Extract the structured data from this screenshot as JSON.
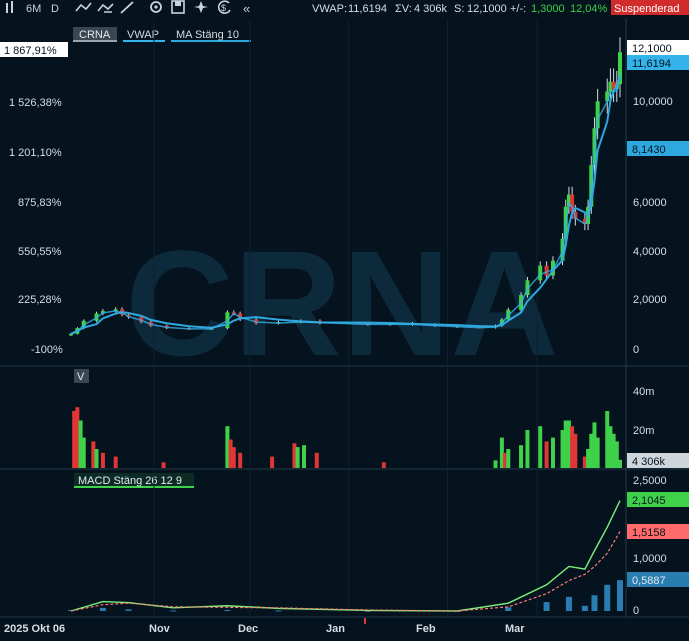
{
  "toolbar": {
    "period": "6M",
    "interval": "D",
    "icons": [
      "candlestick-icon",
      "draw-line-icon",
      "indicator-icon",
      "pencil-icon",
      "settings-icon",
      "save-icon",
      "crosshair-icon",
      "currency-icon",
      "collapse-icon"
    ],
    "vwap_label": "VWAP:",
    "vwap_value": "11,6194",
    "volume_label": "ΣV:",
    "volume_value": "4 306k",
    "last_label": "S:",
    "last_value": "12,1000",
    "change_label": "+/-:",
    "change_value": "1,3000",
    "change_pct": "12,04%",
    "status_badge": "Suspenderad"
  },
  "watermark": "CRNA",
  "price_panel": {
    "legend": [
      "CRNA",
      "VWAP",
      "MA  Stäng 10"
    ],
    "left_axis": [
      "1 867,91%",
      "1 526,38%",
      "1 201,10%",
      "875,83%",
      "550,55%",
      "225,28%",
      "-100%"
    ],
    "right_axis": [
      "10,0000",
      "8,0000",
      "6,0000",
      "4,0000",
      "2,0000",
      "0"
    ],
    "tags": {
      "last": "12,1000",
      "vwap": "11,6194",
      "ma": "8,1430"
    }
  },
  "volume_panel": {
    "legend": "V",
    "axis": [
      "40m",
      "20m"
    ],
    "tag": "4 306k"
  },
  "macd_panel": {
    "legend": "MACD  Stäng 26 12 9",
    "axis": [
      "2,5000",
      "1,0000",
      "0"
    ],
    "tags": {
      "macd": "2,1045",
      "signal": "1,5158",
      "hist": "0,5887"
    }
  },
  "x_axis": [
    "2025 Okt 06",
    "Nov",
    "Dec",
    "Jan",
    "Feb",
    "Mar"
  ],
  "colors": {
    "up": "#3fd14a",
    "down": "#e03636",
    "vwap": "#33b3ea",
    "ma": "#2fa8e0",
    "macd": "#7ef07a",
    "signal": "#ff7a7a",
    "hist": "#2a7db0",
    "background": "#04131d"
  },
  "chart_data": [
    {
      "type": "candlestick",
      "ticker": "CRNA",
      "x_range": [
        "2025-10-06",
        "2026-03-27"
      ],
      "ylim": [
        0,
        12.6
      ],
      "close_series": [
        {
          "date": "2025-10-06",
          "close": 0.62
        },
        {
          "date": "2025-10-08",
          "close": 0.85
        },
        {
          "date": "2025-10-10",
          "close": 1.15
        },
        {
          "date": "2025-10-14",
          "close": 1.45
        },
        {
          "date": "2025-10-16",
          "close": 1.55
        },
        {
          "date": "2025-10-20",
          "close": 1.62
        },
        {
          "date": "2025-10-22",
          "close": 1.4
        },
        {
          "date": "2025-10-24",
          "close": 1.3
        },
        {
          "date": "2025-10-28",
          "close": 1.1
        },
        {
          "date": "2025-10-31",
          "close": 0.95
        },
        {
          "date": "2025-11-05",
          "close": 0.85
        },
        {
          "date": "2025-11-12",
          "close": 0.82
        },
        {
          "date": "2025-11-19",
          "close": 0.85
        },
        {
          "date": "2025-11-24",
          "close": 1.5
        },
        {
          "date": "2025-11-26",
          "close": 1.45
        },
        {
          "date": "2025-11-28",
          "close": 1.2
        },
        {
          "date": "2025-12-03",
          "close": 1.05
        },
        {
          "date": "2025-12-10",
          "close": 1.1
        },
        {
          "date": "2025-12-17",
          "close": 1.15
        },
        {
          "date": "2025-12-23",
          "close": 1.05
        },
        {
          "date": "2026-01-07",
          "close": 1.0
        },
        {
          "date": "2026-01-14",
          "close": 1.05
        },
        {
          "date": "2026-01-21",
          "close": 1.0
        },
        {
          "date": "2026-01-28",
          "close": 0.95
        },
        {
          "date": "2026-02-04",
          "close": 0.9
        },
        {
          "date": "2026-02-11",
          "close": 0.88
        },
        {
          "date": "2026-02-16",
          "close": 0.95
        },
        {
          "date": "2026-02-18",
          "close": 1.2
        },
        {
          "date": "2026-02-20",
          "close": 1.6
        },
        {
          "date": "2026-02-24",
          "close": 2.2
        },
        {
          "date": "2026-02-26",
          "close": 2.8
        },
        {
          "date": "2026-03-02",
          "close": 3.4
        },
        {
          "date": "2026-03-04",
          "close": 3.0
        },
        {
          "date": "2026-03-06",
          "close": 3.6
        },
        {
          "date": "2026-03-09",
          "close": 4.5
        },
        {
          "date": "2026-03-10",
          "close": 5.8
        },
        {
          "date": "2026-03-11",
          "close": 6.3
        },
        {
          "date": "2026-03-12",
          "close": 5.6
        },
        {
          "date": "2026-03-13",
          "close": 5.3
        },
        {
          "date": "2026-03-16",
          "close": 5.1
        },
        {
          "date": "2026-03-17",
          "close": 5.8
        },
        {
          "date": "2026-03-18",
          "close": 7.5
        },
        {
          "date": "2026-03-19",
          "close": 9.0
        },
        {
          "date": "2026-03-20",
          "close": 10.1
        },
        {
          "date": "2026-03-23",
          "close": 10.5
        },
        {
          "date": "2026-03-24",
          "close": 10.9
        },
        {
          "date": "2026-03-25",
          "close": 10.6
        },
        {
          "date": "2026-03-26",
          "close": 10.8
        },
        {
          "date": "2026-03-27",
          "close": 12.1
        }
      ],
      "vwap_last": 11.6194,
      "ma10_last": 8.143,
      "volume_ylim_m": [
        0,
        45
      ],
      "volume_m": [
        {
          "date": "2025-10-07",
          "v": 30,
          "dir": "down"
        },
        {
          "date": "2025-10-08",
          "v": 32,
          "dir": "down"
        },
        {
          "date": "2025-10-09",
          "v": 25,
          "dir": "up"
        },
        {
          "date": "2025-10-10",
          "v": 16,
          "dir": "up"
        },
        {
          "date": "2025-10-13",
          "v": 14,
          "dir": "down"
        },
        {
          "date": "2025-10-14",
          "v": 10,
          "dir": "up"
        },
        {
          "date": "2025-10-16",
          "v": 8,
          "dir": "down"
        },
        {
          "date": "2025-10-20",
          "v": 6,
          "dir": "down"
        },
        {
          "date": "2025-11-04",
          "v": 3,
          "dir": "down"
        },
        {
          "date": "2025-11-24",
          "v": 22,
          "dir": "up"
        },
        {
          "date": "2025-11-25",
          "v": 15,
          "dir": "down"
        },
        {
          "date": "2025-11-26",
          "v": 11,
          "dir": "down"
        },
        {
          "date": "2025-11-28",
          "v": 8,
          "dir": "down"
        },
        {
          "date": "2025-12-08",
          "v": 6,
          "dir": "down"
        },
        {
          "date": "2025-12-15",
          "v": 13,
          "dir": "down"
        },
        {
          "date": "2025-12-16",
          "v": 11,
          "dir": "up"
        },
        {
          "date": "2025-12-18",
          "v": 12,
          "dir": "up"
        },
        {
          "date": "2025-12-22",
          "v": 8,
          "dir": "down"
        },
        {
          "date": "2026-01-12",
          "v": 3,
          "dir": "down"
        },
        {
          "date": "2026-02-16",
          "v": 4,
          "dir": "up"
        },
        {
          "date": "2026-02-18",
          "v": 16,
          "dir": "up"
        },
        {
          "date": "2026-02-19",
          "v": 8,
          "dir": "down"
        },
        {
          "date": "2026-02-20",
          "v": 10,
          "dir": "up"
        },
        {
          "date": "2026-02-24",
          "v": 12,
          "dir": "up"
        },
        {
          "date": "2026-02-26",
          "v": 20,
          "dir": "up"
        },
        {
          "date": "2026-03-02",
          "v": 22,
          "dir": "up"
        },
        {
          "date": "2026-03-04",
          "v": 14,
          "dir": "down"
        },
        {
          "date": "2026-03-06",
          "v": 16,
          "dir": "up"
        },
        {
          "date": "2026-03-09",
          "v": 20,
          "dir": "up"
        },
        {
          "date": "2026-03-10",
          "v": 25,
          "dir": "up"
        },
        {
          "date": "2026-03-11",
          "v": 25,
          "dir": "up"
        },
        {
          "date": "2026-03-12",
          "v": 22,
          "dir": "down"
        },
        {
          "date": "2026-03-13",
          "v": 18,
          "dir": "down"
        },
        {
          "date": "2026-03-16",
          "v": 6,
          "dir": "down"
        },
        {
          "date": "2026-03-17",
          "v": 10,
          "dir": "up"
        },
        {
          "date": "2026-03-18",
          "v": 18,
          "dir": "up"
        },
        {
          "date": "2026-03-19",
          "v": 24,
          "dir": "up"
        },
        {
          "date": "2026-03-20",
          "v": 16,
          "dir": "up"
        },
        {
          "date": "2026-03-23",
          "v": 30,
          "dir": "up"
        },
        {
          "date": "2026-03-24",
          "v": 22,
          "dir": "up"
        },
        {
          "date": "2026-03-25",
          "v": 18,
          "dir": "up"
        },
        {
          "date": "2026-03-26",
          "v": 14,
          "dir": "up"
        },
        {
          "date": "2026-03-27",
          "v": 4.306,
          "dir": "up"
        }
      ],
      "macd_ylim": [
        -0.1,
        2.6
      ],
      "macd": [
        {
          "date": "2025-10-06",
          "macd": 0.0,
          "signal": 0.0,
          "hist": 0.02
        },
        {
          "date": "2025-10-16",
          "macd": 0.18,
          "signal": 0.12,
          "hist": 0.06
        },
        {
          "date": "2025-10-24",
          "macd": 0.16,
          "signal": 0.15,
          "hist": 0.03
        },
        {
          "date": "2025-11-07",
          "macd": 0.06,
          "signal": 0.08,
          "hist": 0.01
        },
        {
          "date": "2025-11-24",
          "macd": 0.1,
          "signal": 0.07,
          "hist": 0.02
        },
        {
          "date": "2025-12-10",
          "macd": 0.05,
          "signal": 0.06,
          "hist": 0.01
        },
        {
          "date": "2026-01-07",
          "macd": 0.01,
          "signal": 0.02,
          "hist": 0.005
        },
        {
          "date": "2026-02-04",
          "macd": 0.0,
          "signal": 0.0,
          "hist": 0.005
        },
        {
          "date": "2026-02-20",
          "macd": 0.15,
          "signal": 0.08,
          "hist": 0.07
        },
        {
          "date": "2026-03-04",
          "macd": 0.5,
          "signal": 0.33,
          "hist": 0.17
        },
        {
          "date": "2026-03-11",
          "macd": 0.85,
          "signal": 0.58,
          "hist": 0.27
        },
        {
          "date": "2026-03-16",
          "macd": 0.8,
          "signal": 0.7,
          "hist": 0.1
        },
        {
          "date": "2026-03-19",
          "macd": 1.15,
          "signal": 0.85,
          "hist": 0.3
        },
        {
          "date": "2026-03-23",
          "macd": 1.6,
          "signal": 1.1,
          "hist": 0.5
        },
        {
          "date": "2026-03-27",
          "macd": 2.1045,
          "signal": 1.5158,
          "hist": 0.5887
        }
      ]
    }
  ]
}
